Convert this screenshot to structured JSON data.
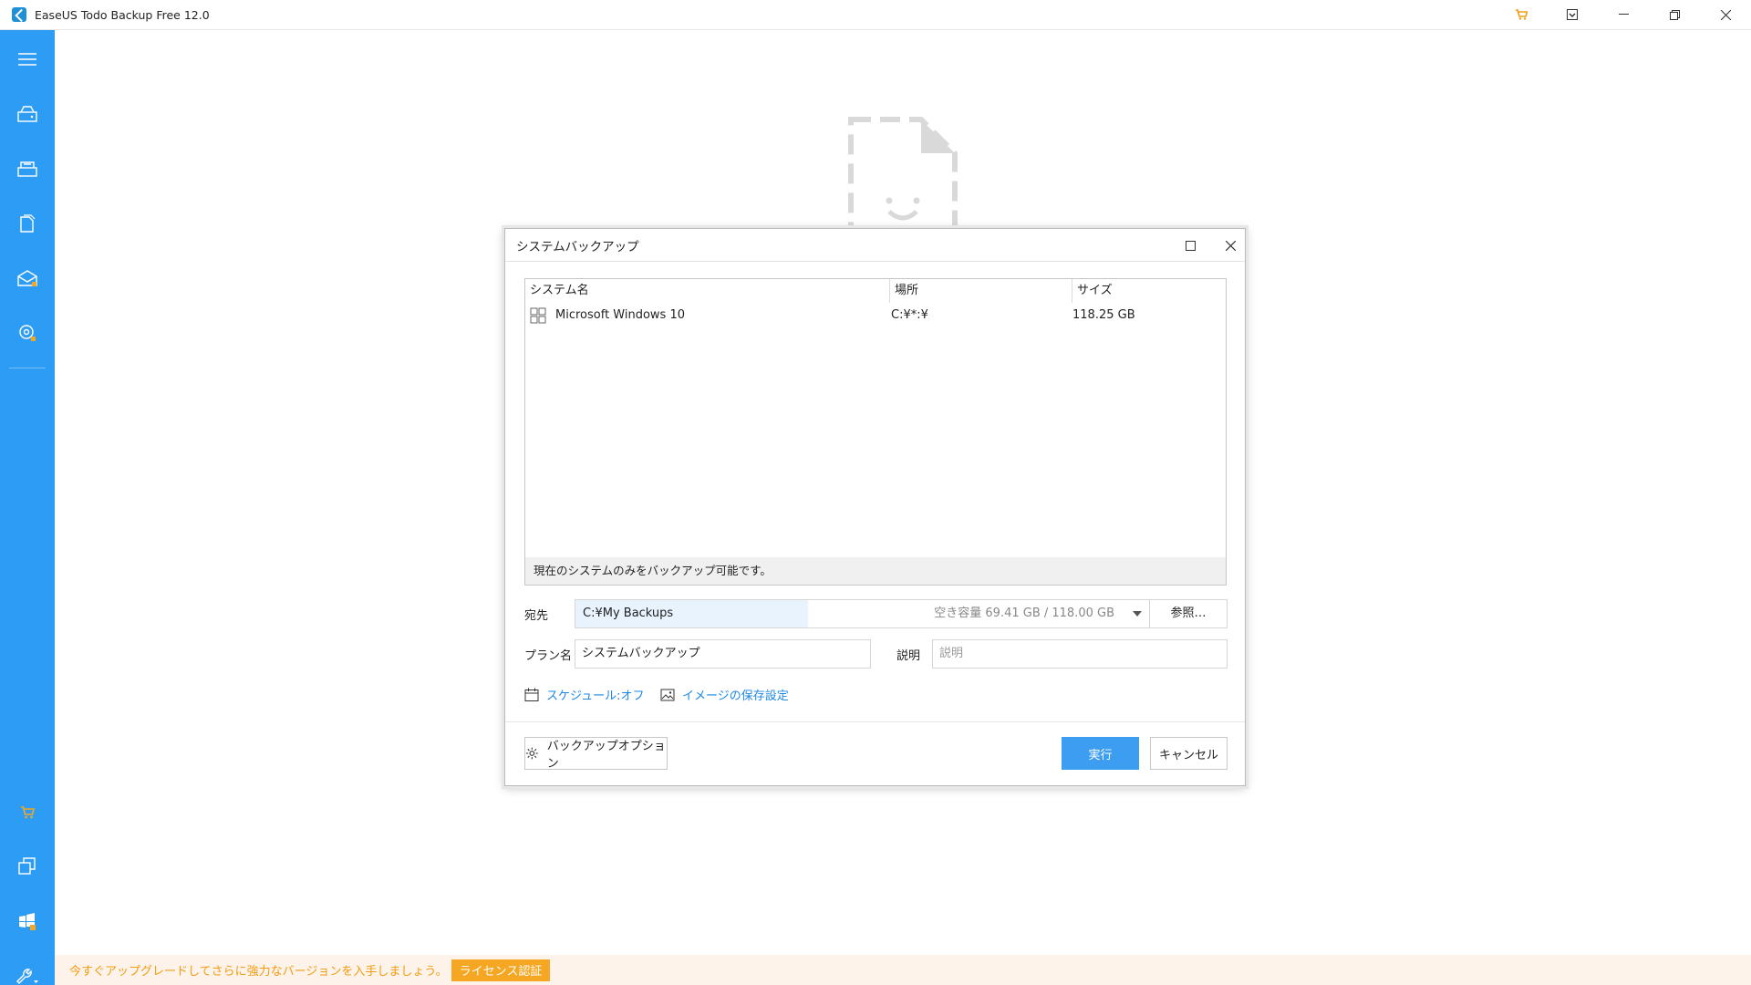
{
  "app": {
    "title": "EaseUS Todo Backup Free 12.0",
    "accent": "#2d9cf4"
  },
  "titlebar": {
    "icons": [
      "cart-icon",
      "download-icon",
      "minimize-icon",
      "restore-icon",
      "close-icon"
    ]
  },
  "sidebar": {
    "top_items": [
      "menu-icon",
      "disk-backup-icon",
      "partition-backup-icon",
      "file-backup-icon",
      "mail-backup-icon",
      "system-backup-icon"
    ],
    "bottom_items": [
      "cart-icon",
      "clone-icon",
      "tools-icon",
      "wrench-icon"
    ]
  },
  "upgrade_bar": {
    "text": "今すぐアップグレードしてさらに強力なバージョンを入手しましょう。",
    "license_label": "ライセンス認証"
  },
  "dialog": {
    "title": "システムバックアップ",
    "table": {
      "columns": [
        "システム名",
        "場所",
        "サイズ"
      ],
      "rows": [
        {
          "name": "Microsoft Windows 10",
          "location": "C:¥*:¥",
          "size": "118.25 GB"
        }
      ],
      "footer": "現在のシステムのみをバックアップ可能です。"
    },
    "destination": {
      "label": "宛先",
      "value": "C:¥My Backups",
      "free_space": "空き容量 69.41 GB / 118.00 GB",
      "browse_label": "参照…"
    },
    "plan": {
      "label": "プラン名",
      "value": "システムバックアップ"
    },
    "description": {
      "label": "説明",
      "placeholder": "説明"
    },
    "schedule_link": "スケジュール:オフ",
    "image_settings_link": "イメージの保存設定",
    "buttons": {
      "options": "バックアップオプション",
      "run": "実行",
      "cancel": "キャンセル"
    }
  }
}
